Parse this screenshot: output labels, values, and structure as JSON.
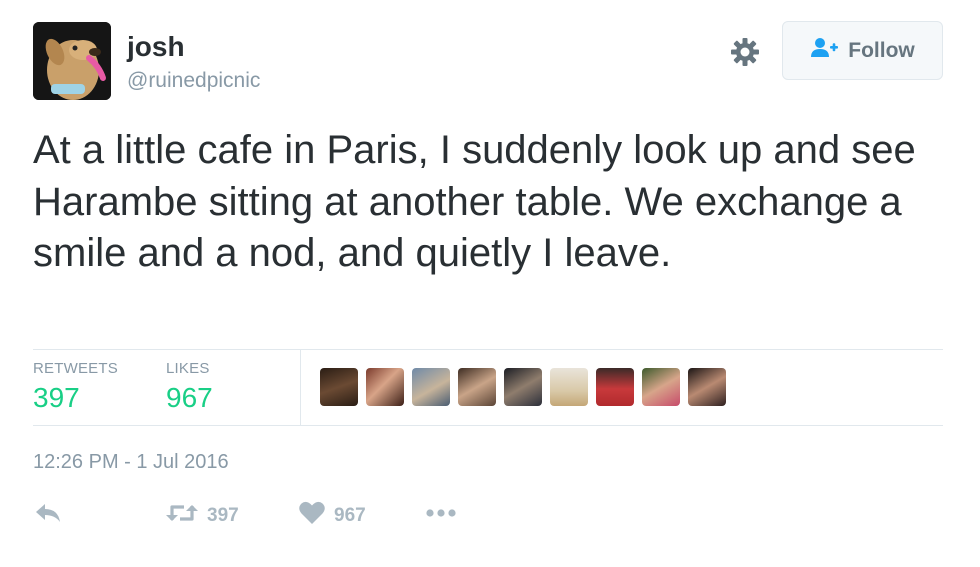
{
  "author": {
    "name": "josh",
    "handle": "@ruinedpicnic"
  },
  "follow_button": {
    "label": "Follow"
  },
  "tweet": {
    "text": "At a little cafe in Paris, I suddenly look up and see Harambe sitting at another table. We exchange a smile and a nod, and quietly I leave."
  },
  "stats": {
    "retweets_label": "RETWEETS",
    "retweets_value": "397",
    "likes_label": "LIKES",
    "likes_value": "967"
  },
  "timestamp": "12:26 PM - 1 Jul 2016",
  "actions": {
    "retweet_count": "397",
    "like_count": "967"
  },
  "colors": {
    "stat_value": "#19cf86",
    "muted": "#8899a6",
    "action_icon": "#aab8c2"
  },
  "icons": [
    "settings-gear-icon",
    "follow-user-icon",
    "reply-icon",
    "retweet-icon",
    "heart-icon",
    "more-icon"
  ]
}
